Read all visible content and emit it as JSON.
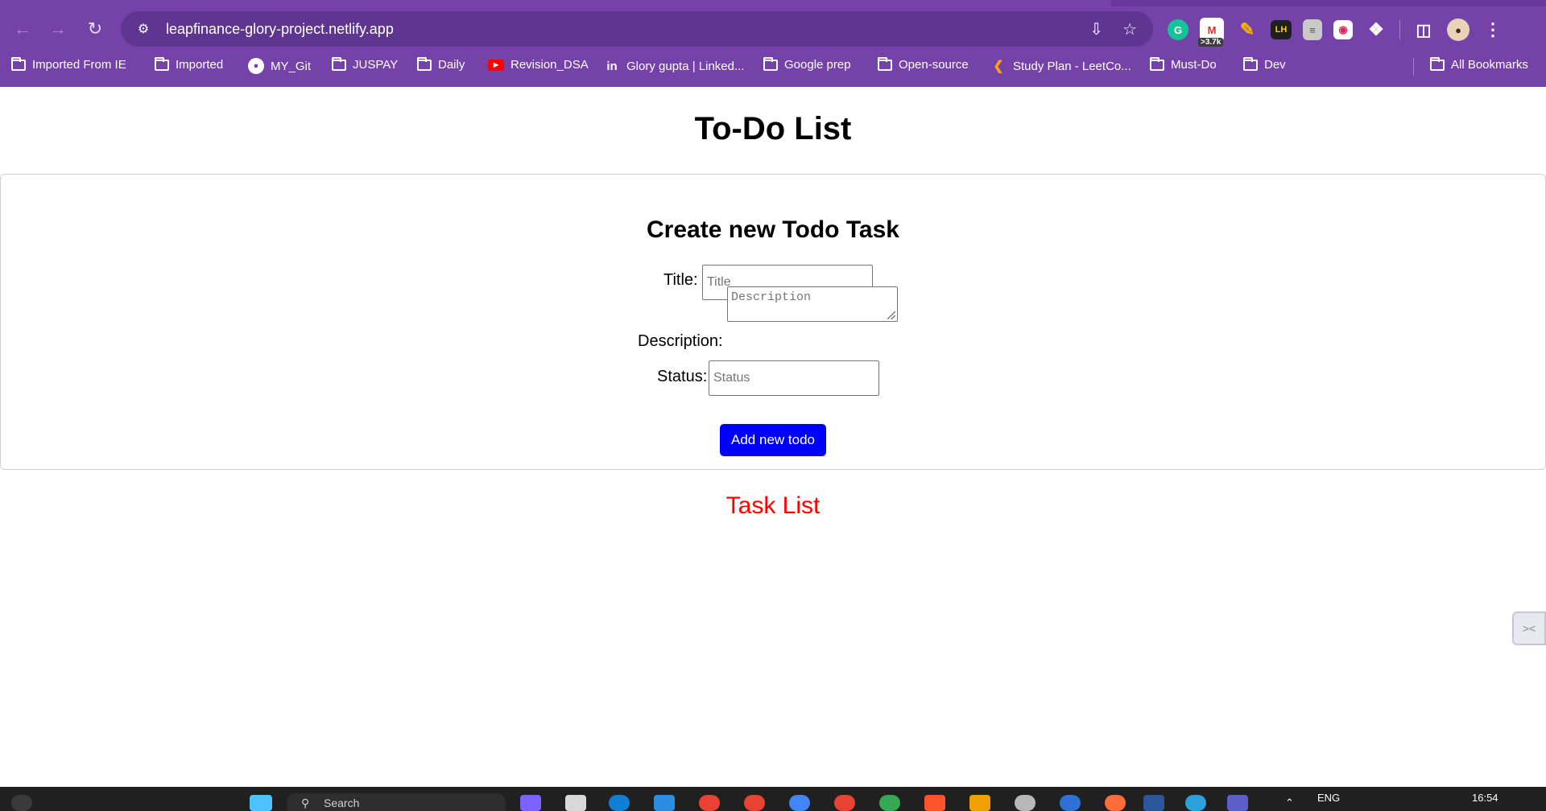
{
  "browser": {
    "url": "leapfinance-glory-project.netlify.app",
    "extensions": {
      "gmail_badge": ">3.7k",
      "lighthouse_label": "LH"
    },
    "bookmarks": [
      {
        "label": "Imported From IE",
        "icon": "folder-icon"
      },
      {
        "label": "Imported",
        "icon": "folder-icon"
      },
      {
        "label": "MY_Git",
        "icon": "github-icon"
      },
      {
        "label": "JUSPAY",
        "icon": "folder-icon"
      },
      {
        "label": "Daily",
        "icon": "folder-icon"
      },
      {
        "label": "Revision_DSA",
        "icon": "youtube-icon"
      },
      {
        "label": "Glory gupta | Linked...",
        "icon": "linkedin-icon"
      },
      {
        "label": "Google prep",
        "icon": "folder-icon"
      },
      {
        "label": "Open-source",
        "icon": "folder-icon"
      },
      {
        "label": "Study Plan - LeetCo...",
        "icon": "leetcode-icon"
      },
      {
        "label": "Must-Do",
        "icon": "folder-icon"
      },
      {
        "label": "Dev",
        "icon": "folder-icon"
      }
    ],
    "all_bookmarks": "All Bookmarks"
  },
  "page": {
    "title": "To-Do List",
    "create": {
      "heading": "Create new Todo Task",
      "title_label": "Title:",
      "title_placeholder": "Title",
      "description_label": "Description:",
      "description_placeholder": "Description",
      "status_label": "Status:",
      "status_placeholder": "Status",
      "add_button": "Add new todo"
    },
    "task_list_heading": "Task List"
  },
  "taskbar": {
    "search_placeholder": "Search",
    "language": "ENG",
    "time": "16:54"
  },
  "colors": {
    "chrome": "#7442a8",
    "add_button": "#0000ff",
    "task_list_heading": "#ff0000"
  }
}
